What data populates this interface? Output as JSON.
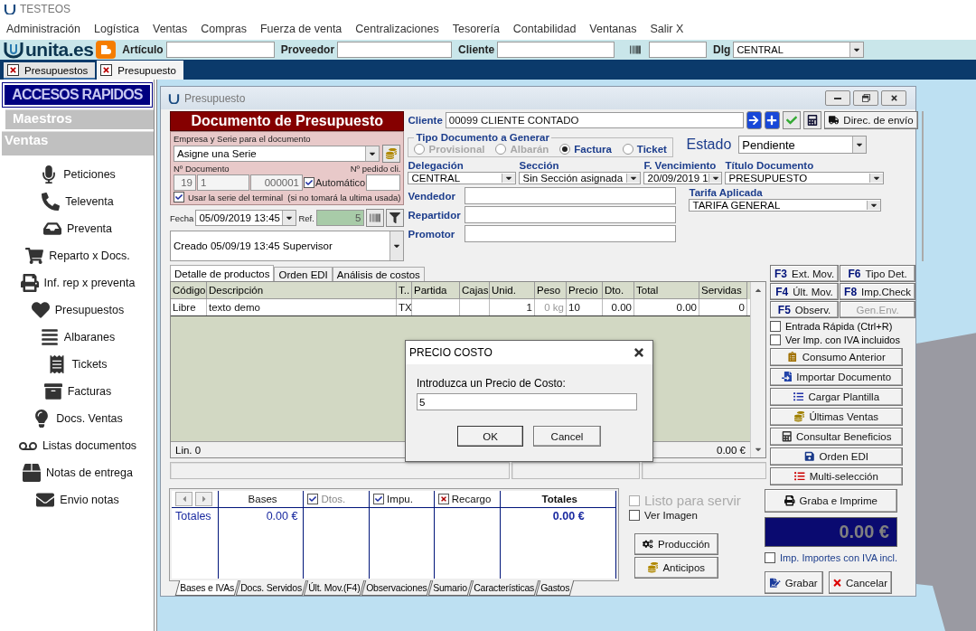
{
  "app": {
    "title": "TESTEOS"
  },
  "menu": [
    "Administración",
    "Logística",
    "Ventas",
    "Compras",
    "Fuerza de venta",
    "Centralizaciones",
    "Tesorería",
    "Contabilidad",
    "Ventanas",
    "Salir X"
  ],
  "toolbar": {
    "logo": "unita.es",
    "fields": [
      {
        "label": "Artículo"
      },
      {
        "label": "Proveedor"
      },
      {
        "label": "Cliente"
      }
    ],
    "dlg": {
      "label": "Dlg",
      "value": "CENTRAL"
    }
  },
  "doc_tabs": [
    {
      "label": "Presupuestos",
      "selected": false
    },
    {
      "label": "Presupuesto",
      "selected": true
    }
  ],
  "sidebar": {
    "title": "ACCESOS RAPIDOS",
    "groups": [
      "Maestros",
      "Ventas"
    ],
    "items": [
      "Peticiones",
      "Televenta",
      "Preventa",
      "Reparto x Docs.",
      "Inf. rep x preventa",
      "Presupuestos",
      "Albaranes",
      "Tickets",
      "Facturas",
      "Docs. Ventas",
      "Listas documentos",
      "Notas de entrega",
      "Envio notas"
    ]
  },
  "window": {
    "title": "Presupuesto"
  },
  "header": {
    "title": "Documento de Presupuesto",
    "serie_label": "Empresa y Serie para el documento",
    "serie": "Asigne una Serie",
    "doc_number_label": "Nº Documento",
    "doc_number": [
      "19",
      "1",
      "000001"
    ],
    "automatic": {
      "label": "Automático",
      "checked": true
    },
    "order_label": "Nº pedido cli.",
    "use_terminal": {
      "label": "Usar la serie del terminal  (si no tomará la ultima usada)",
      "checked": true
    },
    "date_label": "Fecha",
    "date": "05/09/2019 13:45",
    "ref_label": "Ref.",
    "ref": "5",
    "created": "Creado 05/09/19 13:45 Supervisor"
  },
  "client": {
    "label": "Cliente",
    "value": "00099 CLIENTE CONTADO",
    "shipping_button": "Direc. de envío"
  },
  "doc_type": {
    "title": "Tipo Documento a Generar",
    "options": [
      {
        "label": "Provisional",
        "selected": false,
        "disabled": true
      },
      {
        "label": "Albarán",
        "selected": false,
        "disabled": true
      },
      {
        "label": "Factura",
        "selected": true,
        "disabled": false
      },
      {
        "label": "Ticket",
        "selected": false,
        "disabled": false
      }
    ]
  },
  "status": {
    "label": "Estado",
    "value": "Pendiente"
  },
  "selects": [
    {
      "label": "Delegación",
      "value": "CENTRAL"
    },
    {
      "label": "Sección",
      "value": "Sin Sección asignada"
    },
    {
      "label": "F. Vencimiento",
      "value": "20/09/2019 1"
    },
    {
      "label": "Título Documento",
      "value": "PRESUPUESTO"
    }
  ],
  "people": [
    "Vendedor",
    "Repartidor",
    "Promotor"
  ],
  "tariff": {
    "label": "Tarifa Aplicada",
    "value": "TARIFA GENERAL"
  },
  "detail_tabs": [
    {
      "label": "Detalle de productos",
      "selected": true
    },
    {
      "label": "Orden EDI",
      "selected": false
    },
    {
      "label": "Análisis de costos",
      "selected": false
    }
  ],
  "table": {
    "columns": [
      "Código",
      "Descripción",
      "T..",
      "Partida",
      "Cajas",
      "Unid.",
      "Peso",
      "Precio",
      "Dto.",
      "Total",
      "Servidas"
    ],
    "rows": [
      [
        "Libre",
        "texto demo",
        "TX",
        null,
        null,
        "1",
        "0 kg",
        "10",
        "0.00",
        "0.00",
        "0"
      ]
    ],
    "lines": "Lin. 0",
    "total": "0.00 €"
  },
  "function_keys": [
    {
      "key": "F3",
      "label": "Ext. Mov.",
      "disabled": false
    },
    {
      "key": "F6",
      "label": "Tipo Det.",
      "disabled": false
    },
    {
      "key": "F4",
      "label": "Últ. Mov.",
      "disabled": false
    },
    {
      "key": "F8",
      "label": "Imp.Check",
      "disabled": false
    },
    {
      "key": "F5",
      "label": "Observ.",
      "disabled": false
    },
    {
      "label": "Gen.Env.",
      "disabled": true
    }
  ],
  "options": [
    {
      "label": "Entrada Rápida (Ctrl+R)",
      "checked": false
    },
    {
      "label": "Ver Imp. con IVA incluidos",
      "checked": false
    }
  ],
  "actions": [
    "Consumo Anterior",
    "Importar Documento",
    "Cargar Plantilla",
    "Últimas Ventas",
    "Consultar Beneficios",
    "Orden EDI",
    "Multi-selección"
  ],
  "summary": {
    "columns": [
      {
        "label": "Bases",
        "kind": "plain"
      },
      {
        "label": "Dtos.",
        "kind": "tick",
        "checked": true,
        "disabled": true
      },
      {
        "label": "Impu.",
        "kind": "tick",
        "checked": true,
        "disabled": false
      },
      {
        "label": "Recargo",
        "kind": "cross",
        "checked": true,
        "disabled": false
      },
      {
        "label": "Totales",
        "kind": "bold"
      }
    ],
    "row_label": "Totales",
    "bases": "0.00 €",
    "total": "0.00 €"
  },
  "bottom_tabs": [
    {
      "label": "Bases e IVAs",
      "selected": true
    },
    {
      "label": "Docs. Servidos",
      "selected": false
    },
    {
      "label": "Últ. Mov.(F4)",
      "selected": false
    },
    {
      "label": "Observaciones",
      "selected": false
    },
    {
      "label": "Sumario",
      "selected": false
    },
    {
      "label": "Características",
      "selected": false
    },
    {
      "label": "Gastos",
      "selected": false
    }
  ],
  "side_options": [
    {
      "label": "Listo para servir",
      "checked": false,
      "disabled": true
    },
    {
      "label": "Ver Imagen",
      "checked": false,
      "disabled": false
    }
  ],
  "side_buttons": [
    "Producción",
    "Anticipos"
  ],
  "print_button": "Graba e Imprime",
  "grand_total": "0.00 €",
  "vat_option": {
    "label": "Imp. Importes con IVA incl.",
    "checked": false
  },
  "final_buttons": [
    "Grabar",
    "Cancelar"
  ],
  "dialog": {
    "title": "PRECIO COSTO",
    "prompt": "Introduzca un Precio de Costo:",
    "value": "5",
    "buttons": [
      "OK",
      "Cancel"
    ]
  }
}
